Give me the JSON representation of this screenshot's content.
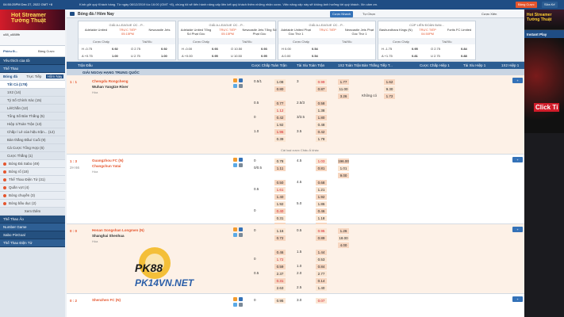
{
  "top": {
    "clock": "04:50:25PM Dec 27, 2022 GMT +8",
    "ticker": "Kính gửi quý Khách hàng. Từ ngày 08/12/2019 lúc 16:00 (GMT +8), chúng tôi sẽ tiến hành nâng cấp liên kết quý khách thêm những nhận cược. Việc nâng cấp này sẽ không ảnh hưởng tới quý khách. Xin cảm ơn.",
    "buttons": [
      "Bảng Cược",
      "Sửa Kế"
    ]
  },
  "left": {
    "promo": "Hot Streamer Tường Thuật",
    "account": "u88_u888fb",
    "balance_label": "Phiếu Đ...",
    "bet_label": "Bảng Cược",
    "fav": "Yêu thích của tôi",
    "sports": "Thể Thao",
    "tabs": [
      "Bóng đá",
      "Trực Tiếp",
      "Hôm Nay"
    ],
    "items": [
      "Tất Cả",
      "1X2",
      "Tỷ Số Chính Xác",
      "Lẻ/Chẵn",
      "Tổng Số Bàn Thắng",
      "Hiệp 1/Toàn Trận",
      "Chấp / Lẻ của hiệu trận...",
      "Bàn thắng Đầu/ Cuối",
      "Cá Cược Tổng Hợp",
      "Cược Thắng"
    ],
    "counts": [
      "(178)",
      "(14)",
      "(15)",
      "(12)",
      "(5)",
      "(13)",
      "(12)",
      "(9)",
      "(6)",
      "(1)"
    ],
    "sports_list": [
      "Bóng Đá Sabo",
      "Bóng rổ",
      "Thể Thao Điện Tử",
      "Quần vợt",
      "Bóng chuyền",
      "Bóng bầu dục"
    ],
    "sport_counts": [
      "(49)",
      "(18)",
      "(31)",
      "(4)",
      "(3)",
      "(2)"
    ],
    "more": "Xem thêm",
    "bottom": [
      "Thể Thao Ảo",
      "Number Game",
      "Sabo PinGoal",
      "Thể Thao Điện Tử"
    ]
  },
  "center": {
    "title": "Bóng đá / Hôm Nay",
    "toolbar": [
      "Cược Nhanh",
      "Tự Chọn",
      "Cược Xiên"
    ],
    "cards": [
      {
        "league": "GIẢI A-LEAGUE ÚC - P...",
        "home": "Adelaide United",
        "away": "Newcastle Jets",
        "status": "TRỰC TIẾP 05:15PM",
        "cols": [
          "Cược Chấp",
          "Tài/Xỉu"
        ],
        "r1": [
          "H  -0.75",
          "0.92",
          "O 2.75",
          "0.92"
        ],
        "r2": [
          "A +0.75",
          "1.00",
          "U 2.75",
          "1.00"
        ]
      },
      {
        "league": "GIẢI A-LEAGUE ÚC - P...",
        "home": "Adelaide United Tổng Số Phạt Góc",
        "away": "Newcastle Jets Tổng Số Phạt Góc",
        "status": "TRỰC TIẾP 05:15PM",
        "cols": [
          "Cược Chấp",
          "Tài/Xỉu"
        ],
        "r1": [
          "H  -0.00",
          "0.93",
          "O 10.50",
          "0.93"
        ],
        "r2": [
          "A +0.00",
          "0.95",
          "U 10.50",
          "0.95"
        ]
      },
      {
        "league": "GIẢI A-LEAGUE ÚC - P...",
        "home": "Adelaide United Phạt Góc Thứ 1",
        "away": "Newcastle Jets Phạt Góc Thứ 1",
        "status": "TRỰC TIẾP",
        "cols": [
          "Cược Chấp",
          "Tài/Xỉu"
        ],
        "r1": [
          "H  0.00",
          "0.54",
          "",
          ""
        ],
        "r2": [
          "A 0.00",
          "0.54",
          "",
          ""
        ]
      },
      {
        "league": "CÚP LIÊN ĐOÀN BAN...",
        "home": "Bashundhara Kings (N)",
        "away": "Fortis FC Limited",
        "status": "TRỰC TIẾP 04:50PM",
        "cols": [
          "Cược Chấp",
          "Tài/Xỉu"
        ],
        "r1": [
          "H  -1.75",
          "0.95",
          "O 2.75",
          "0.84"
        ],
        "r2": [
          "A +1.75",
          "0.81",
          "U 2.75",
          "0.88"
        ]
      }
    ],
    "header": [
      "Trận Đấu",
      "Cược Chấp Toàn Trận",
      "Tài Xỉu Toàn Trận",
      "1X2 Toàn Trận",
      "Bàn Thắng Tiếp T...",
      "Cược Chấp Hiệp 1",
      "Tài Xỉu Hiệp 1",
      "1X2 Hiệp 1"
    ],
    "league": "GIẢI NGOẠI HẠNG TRUNG QUỐC",
    "matches": [
      {
        "score": "1 : 1",
        "time": "",
        "home": "Chengdu Rongcheng",
        "away": "Wuhan Yangtze River",
        "draw": "Hòa",
        "rows": [
          [
            "0.5/1",
            "1.08",
            "3",
            "0.99",
            "1.77",
            "",
            "1.62"
          ],
          [
            "",
            "0.80",
            "",
            "0.87",
            "11.00",
            "",
            "9.30"
          ],
          [
            "",
            "",
            "",
            "",
            "3.26",
            "Không có",
            "1.72"
          ],
          [
            "0.5",
            "0.77",
            "2.5/3",
            "0.58",
            "",
            "",
            ""
          ],
          [
            "",
            "1.12",
            "",
            "1.38",
            "",
            "",
            ""
          ],
          [
            "0",
            "0.42",
            "3/3.5",
            "1.80",
            "",
            "",
            ""
          ],
          [
            "",
            "1.92",
            "",
            "0.48",
            "",
            "",
            ""
          ],
          [
            "1.0",
            "1.96",
            "3.5",
            "0.42",
            "",
            "",
            ""
          ],
          [
            "",
            "0.39",
            "",
            "1.78",
            "",
            "",
            ""
          ]
        ]
      },
      {
        "score": "1 : 3",
        "time": "2H 66",
        "home": "Guangzhou FC (N)",
        "away": "Changchun Yatai",
        "draw": "Hòa",
        "rows": [
          [
            "0",
            "0.78",
            "4.5",
            "1.03",
            "196.00",
            "",
            ""
          ],
          [
            "0/0.5",
            "1.11",
            "",
            "0.81",
            "1.01",
            "",
            ""
          ],
          [
            "",
            "",
            "",
            "",
            "9.00",
            "",
            ""
          ],
          [
            "",
            "0.50",
            "4.5",
            "0.68",
            "",
            "",
            ""
          ],
          [
            "0.5",
            "1.61",
            "",
            "1.21",
            "",
            "",
            ""
          ],
          [
            "",
            "1.40",
            "",
            "1.92",
            "",
            "",
            ""
          ],
          [
            "",
            "1.92",
            "5.0",
            "1.86",
            "",
            "",
            ""
          ],
          [
            "0",
            "0.40",
            "",
            "0.46",
            "",
            "",
            ""
          ],
          [
            "",
            "0.31",
            "",
            "1.18",
            "",
            "",
            ""
          ],
          [
            "",
            "2.53",
            "",
            "0.29",
            "",
            "",
            ""
          ]
        ]
      },
      {
        "score": "0 : 0",
        "time": "",
        "home": "Henan Songshan Longmen (N)",
        "away": "Shanghai Shenhua",
        "draw": "Hòa",
        "rows": [
          [
            "0",
            "1.16",
            "0.5",
            "0.95",
            "1.26",
            "",
            ""
          ],
          [
            "",
            "0.72",
            "",
            "0.89",
            "18.00",
            "",
            ""
          ],
          [
            "",
            "",
            "",
            "",
            "4.00",
            "",
            ""
          ],
          [
            "",
            "0.46",
            "1.5",
            "1.44",
            "",
            "",
            ""
          ],
          [
            "0",
            "1.72",
            "",
            "0.53",
            "",
            "",
            ""
          ],
          [
            "",
            "0.59",
            "1.0",
            "0.84",
            "",
            "",
            ""
          ],
          [
            "0.5",
            "2.37",
            "2.0",
            "2.77",
            "",
            "",
            ""
          ],
          [
            "",
            "0.31",
            "",
            "0.14",
            "",
            "",
            ""
          ],
          [
            "",
            "2.63",
            "2.5",
            "1.40",
            "",
            "",
            ""
          ]
        ]
      },
      {
        "score": "0 : 2",
        "time": "",
        "home": "Shenzhen FC (N)",
        "away": "",
        "draw": "",
        "rows": [
          [
            "0",
            "0.95",
            "3.0",
            "0.07",
            "",
            "",
            ""
          ]
        ]
      }
    ],
    "coming": "Cài loại cược Châu Á khác"
  },
  "right": {
    "promo": "Hot Streamer Tường Thuật",
    "instant": "Instant Play",
    "ad": "Click Tỉ"
  },
  "watermark": {
    "logo": "PK88",
    "url": "PK14VN.NET"
  },
  "colors": {
    "navy": "#1f4d84",
    "orange": "#e5552d",
    "odd": "#f7d7c1"
  }
}
